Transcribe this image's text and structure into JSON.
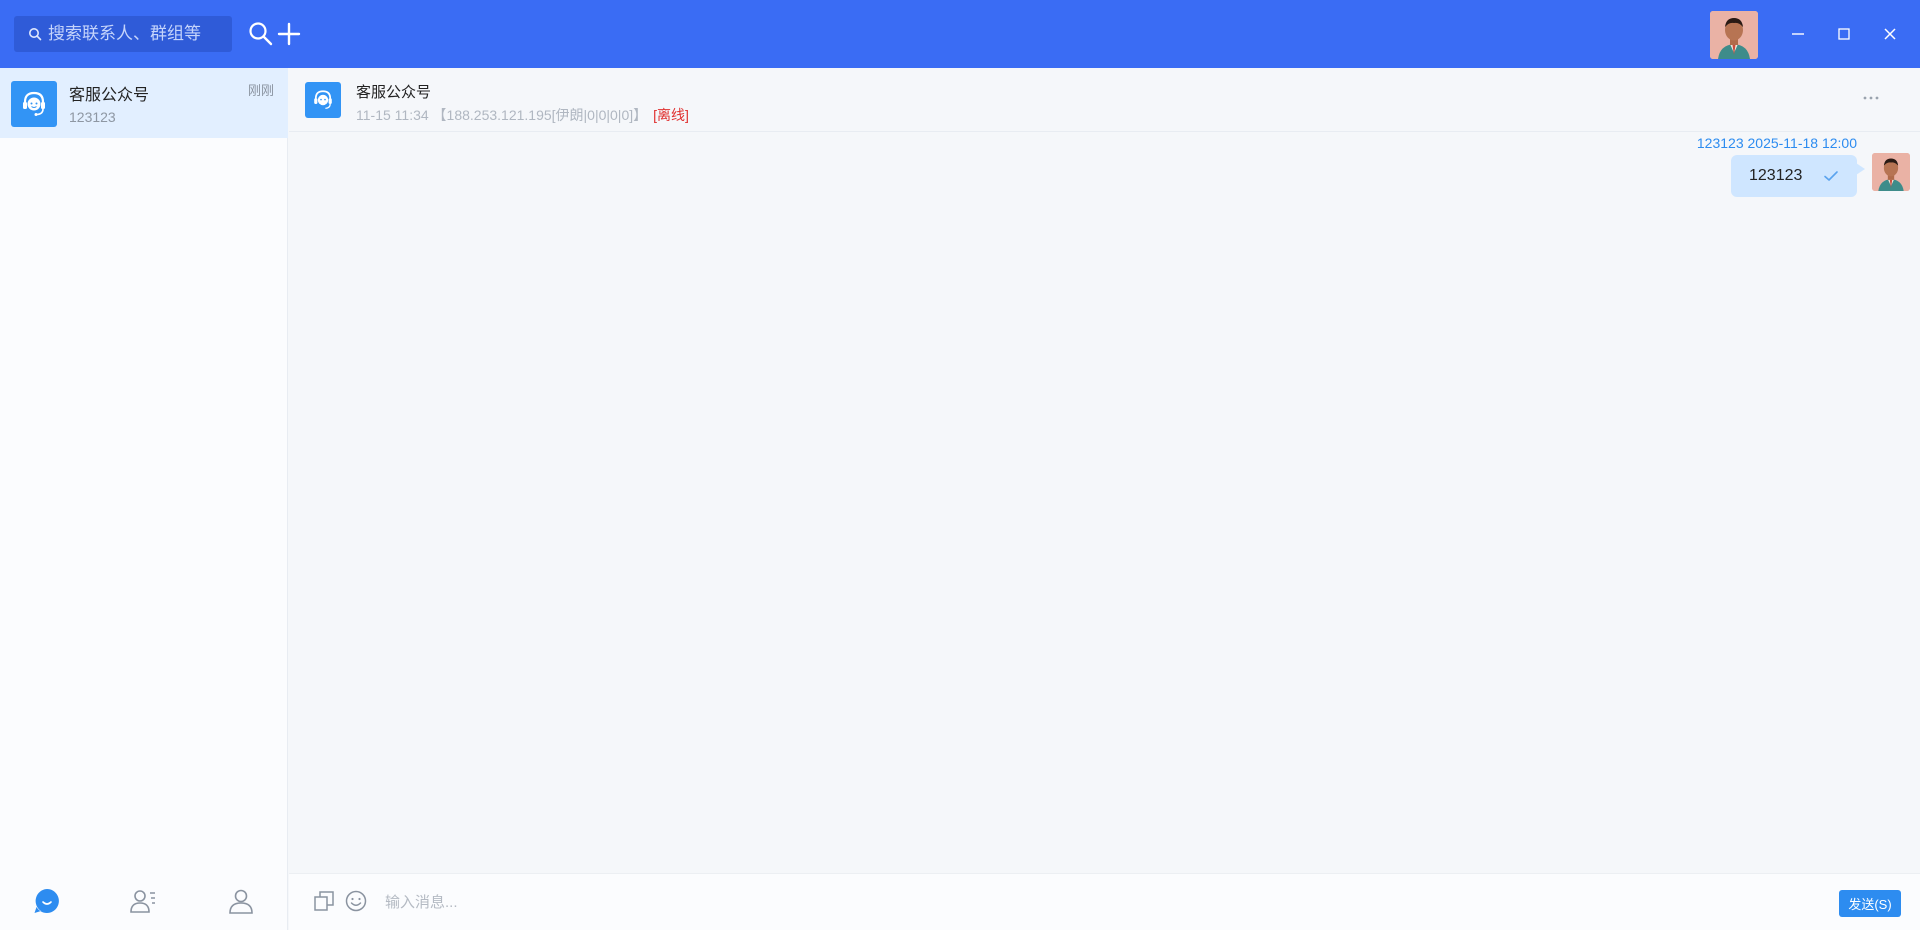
{
  "topbar": {
    "search_placeholder": "搜索联系人、群组等",
    "icons": [
      "search-icon",
      "plus-icon",
      "minimize-icon",
      "maximize-icon",
      "close-icon"
    ]
  },
  "sidebar": {
    "conversations": [
      {
        "name": "客服公众号",
        "time": "刚刚",
        "preview": "123123",
        "icon": "headset-icon",
        "selected": true
      }
    ],
    "bottom_nav": [
      "chat-icon",
      "contacts-icon",
      "profile-icon"
    ]
  },
  "chat": {
    "title": "客服公众号",
    "subtitle": "11-15 11:34 【188.253.121.195[伊朗|0|0|0|0]】",
    "status": "[离线]",
    "messages": [
      {
        "sender": "123123",
        "time": "2025-11-18 12:00",
        "meta": "123123 2025-11-18 12:00",
        "text": "123123",
        "read": true
      }
    ]
  },
  "input": {
    "placeholder": "输入消息...",
    "send_label": "发送(S)"
  },
  "colors": {
    "topbar": "#3a6cf4",
    "accent": "#2d8cf0",
    "selected_item": "#e2efff",
    "bubble": "#cfe6ff",
    "offline": "#e0302f"
  }
}
